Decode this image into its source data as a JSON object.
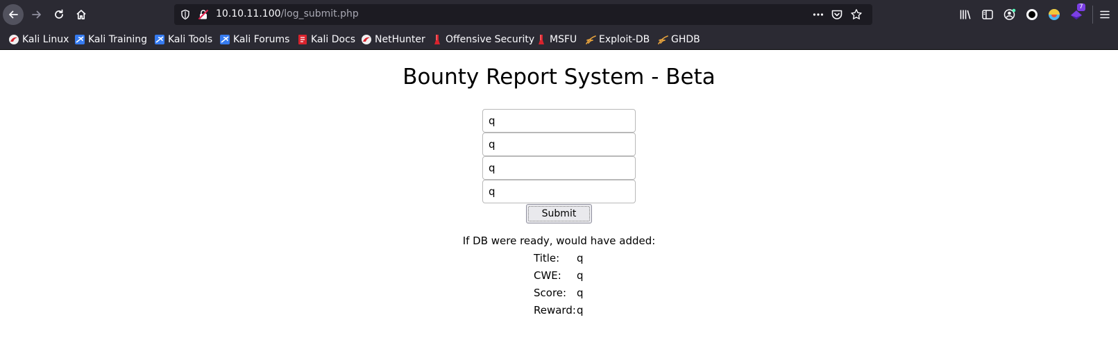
{
  "browser": {
    "url_host": "10.10.11.100",
    "url_path": "/log_submit.php",
    "extension_badge": "7"
  },
  "bookmarks": [
    {
      "label": "Kali Linux",
      "icon": "kali-icon"
    },
    {
      "label": "Kali Training",
      "icon": "kali-training-icon"
    },
    {
      "label": "Kali Tools",
      "icon": "kali-tools-icon"
    },
    {
      "label": "Kali Forums",
      "icon": "kali-forums-icon"
    },
    {
      "label": "Kali Docs",
      "icon": "kali-docs-icon"
    },
    {
      "label": "NetHunter",
      "icon": "nethunter-icon"
    },
    {
      "label": "Offensive Security",
      "icon": "offsec-icon"
    },
    {
      "label": "MSFU",
      "icon": "msfu-icon"
    },
    {
      "label": "Exploit-DB",
      "icon": "exploit-db-icon"
    },
    {
      "label": "GHDB",
      "icon": "ghdb-icon"
    }
  ],
  "page": {
    "title": "Bounty Report System - Beta",
    "fields": [
      "q",
      "q",
      "q",
      "q"
    ],
    "submit_label": "Submit",
    "result_heading": "If DB were ready, would have added:",
    "results": [
      {
        "label": "Title:",
        "value": "q"
      },
      {
        "label": "CWE:",
        "value": "q"
      },
      {
        "label": "Score:",
        "value": "q"
      },
      {
        "label": "Reward:",
        "value": "q"
      }
    ]
  }
}
